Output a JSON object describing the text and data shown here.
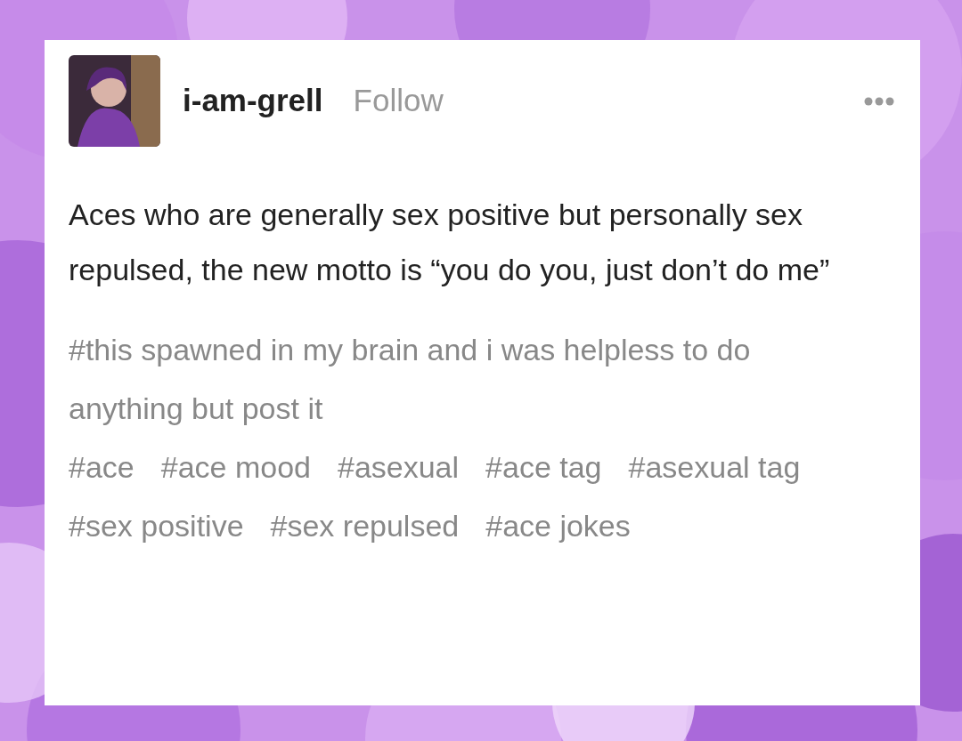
{
  "post": {
    "username": "i-am-grell",
    "follow": "Follow",
    "body": "Aces who are generally sex positive but personally sex repulsed, the new motto is “you do you, just don’t do me”",
    "tags": [
      "#this spawned in my brain and i was helpless to do anything but post it",
      "#ace",
      "#ace mood",
      "#asexual",
      "#ace tag",
      "#asexual tag",
      "#sex positive",
      "#sex repulsed",
      "#ace jokes"
    ]
  }
}
